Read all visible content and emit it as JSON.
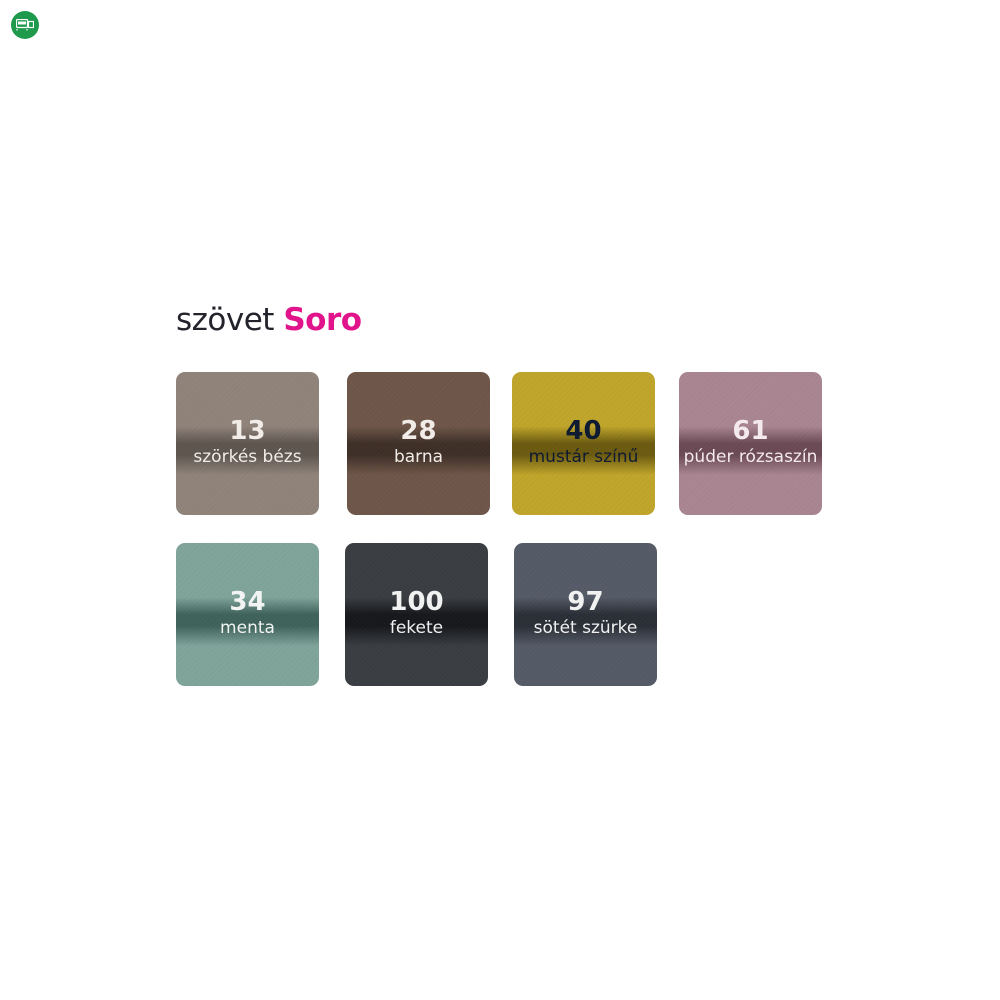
{
  "badge": {
    "icon": "sofa-bed-icon",
    "color": "#1f9a4d"
  },
  "header": {
    "prefix": "szövet",
    "brand": "Soro",
    "brand_color": "#e2148b"
  },
  "swatches": [
    {
      "number": "13",
      "name": "szörkés bézs",
      "color": "#8f837a",
      "band": "#5e554f",
      "text_color": "#f1ece7"
    },
    {
      "number": "28",
      "name": "barna",
      "color": "#6e5649",
      "band": "#3e2f27",
      "text_color": "#f1ece7"
    },
    {
      "number": "40",
      "name": "mustár színű",
      "color": "#bfa52a",
      "band": "#6b5a10",
      "text_color": "#0f1a33"
    },
    {
      "number": "61",
      "name": "púder rózsaszín",
      "color": "#a88591",
      "band": "#6b4a55",
      "text_color": "#f4eaee"
    },
    {
      "number": "34",
      "name": "menta",
      "color": "#7fa49a",
      "band": "#3f625a",
      "text_color": "#f1f4f2"
    },
    {
      "number": "100",
      "name": "fekete",
      "color": "#3a3d42",
      "band": "#16181b",
      "text_color": "#f1f1f1"
    },
    {
      "number": "97",
      "name": "sötét szürke",
      "color": "#545a66",
      "band": "#2a2e36",
      "text_color": "#f1f1f1"
    }
  ]
}
